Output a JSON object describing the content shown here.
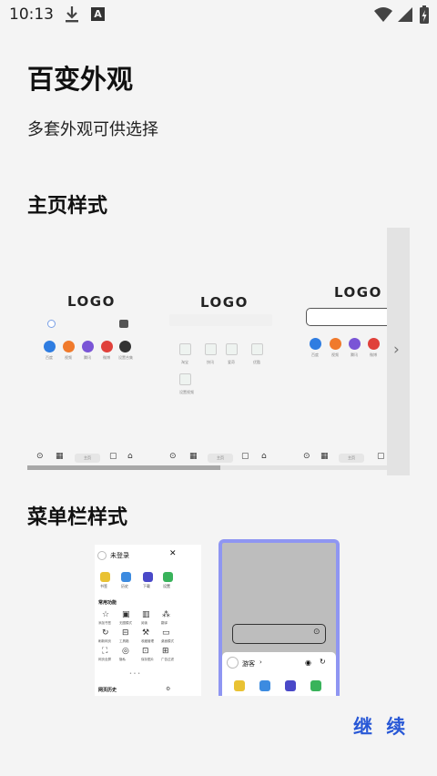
{
  "status_bar": {
    "time": "10:13"
  },
  "page": {
    "title": "百变外观",
    "subtitle": "多套外观可供选择",
    "homepage_section": "主页样式",
    "menubar_section": "菜单栏样式",
    "continue_label": "继 续"
  },
  "home_previews": [
    {
      "logo": "LOGO",
      "apps": [
        "百度",
        "视频",
        "腾讯",
        "微博",
        "设置合集"
      ]
    },
    {
      "logo": "LOGO",
      "apps": [
        "淘宝",
        "快讯",
        "爱奇",
        "优酷",
        "设置视频"
      ]
    },
    {
      "logo": "LOGO",
      "apps": [
        "百度",
        "视频",
        "腾讯",
        "微博"
      ]
    }
  ],
  "navbar": {
    "home_pill": "主页"
  },
  "menu_preview_1": {
    "user_label": "未登录",
    "shortcuts": [
      "书签",
      "历史",
      "下载",
      "设置"
    ],
    "section": "常用功能",
    "features": [
      "添加书签",
      "无图模式",
      "阅读",
      "翻译",
      "刷新网页",
      "工具箱",
      "收藏管理",
      "桌面模式",
      "网页全屏",
      "隐私",
      "保存图片",
      "广告过滤"
    ],
    "footer": "网页历史"
  },
  "menu_preview_2": {
    "user_label": "游客"
  },
  "colors": {
    "accent": "#2858d6",
    "menu2_border": "#8f96f2",
    "app_colors": [
      "#2f7de1",
      "#f07a2c",
      "#7a55d6",
      "#e0413b",
      "#333333"
    ]
  }
}
